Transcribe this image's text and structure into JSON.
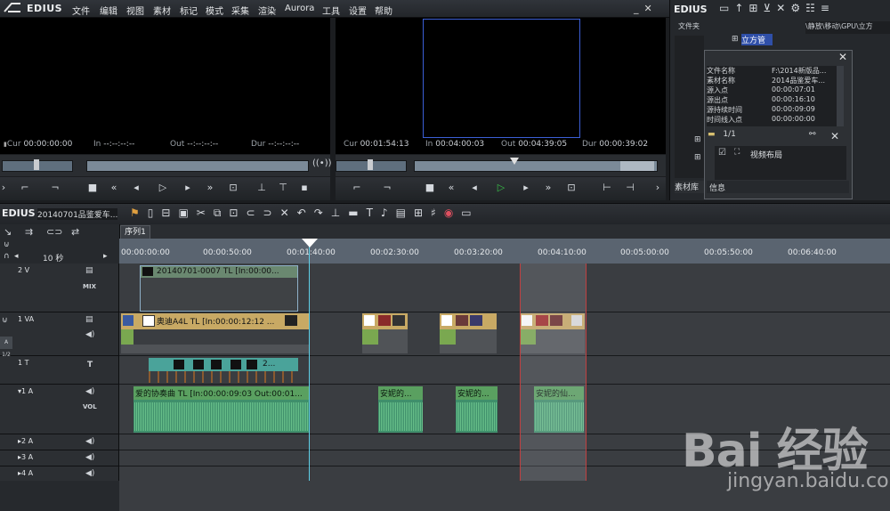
{
  "app": {
    "name": "EDIUS"
  },
  "menu": [
    "文件",
    "编辑",
    "视图",
    "素材",
    "标记",
    "模式",
    "采集",
    "渲染",
    "Aurora",
    "工具",
    "设置",
    "帮助"
  ],
  "player": {
    "cur_label": "Cur",
    "cur_value": "00:00:00:00",
    "in_label": "In",
    "in_value": "--:--:--:--",
    "out_label": "Out",
    "out_value": "--:--:--:--",
    "dur_label": "Dur",
    "dur_value": "--:--:--:--"
  },
  "recorder": {
    "cur_label": "Cur",
    "cur_value": "00:01:54:13",
    "in_label": "In",
    "in_value": "00:04:00:03",
    "out_label": "Out",
    "out_value": "00:04:39:05",
    "dur_label": "Dur",
    "dur_value": "00:00:39:02"
  },
  "bin": {
    "title": "EDIUS",
    "folder_header": "文件夹",
    "path": "\\静放\\移动\\GPU\\立方",
    "tree_item": "立方管",
    "tab_label": "素材库"
  },
  "info_panel": {
    "rows": [
      {
        "k": "文件名称",
        "v": "F:\\2014新版品..."
      },
      {
        "k": "素材名称",
        "v": "2014品鉴爱车..."
      },
      {
        "k": "源入点",
        "v": "00:00:07:01"
      },
      {
        "k": "源出点",
        "v": "00:00:16:10"
      },
      {
        "k": "源持续时间",
        "v": "00:00:09:09"
      },
      {
        "k": "时间线入点",
        "v": "00:00:00:00"
      }
    ],
    "page": "1/1",
    "layout_label": "视频布局",
    "tab": "信息"
  },
  "timeline": {
    "logo": "EDIUS",
    "project_name": "20140701品鉴爱车...",
    "sequence_tab": "序列1",
    "zoom": "10 秒",
    "ruler_ticks": [
      "00:00:00:00",
      "00:00:50:00",
      "00:01:40:00",
      "00:02:30:00",
      "00:03:20:00",
      "00:04:10:00",
      "00:05:00:00",
      "00:05:50:00",
      "00:06:40:00"
    ]
  },
  "tracks": [
    {
      "name": "2 V",
      "badge": "MIX"
    },
    {
      "name": "1 VA",
      "badge": "A 1/2"
    },
    {
      "name": "1 T",
      "badge": "T"
    },
    {
      "name": "▾1 A",
      "badge": "VOL"
    },
    {
      "name": "▸2 A",
      "badge": ""
    },
    {
      "name": "▸3 A",
      "badge": ""
    },
    {
      "name": "▸4 A",
      "badge": ""
    }
  ],
  "clips": {
    "v2_title": "20140701-0007  TL [In:00:00...",
    "va_title": "奥迪A4L  TL [In:00:00:12:12 ...",
    "t_title": "2...",
    "a1_title": "爱的协奏曲  TL [In:00:00:09:03 Out:00:01...",
    "a2_title": "安妮的...",
    "a3_title": "安妮的...",
    "a4_title": "安妮的仙..."
  },
  "watermark": {
    "main": "Bai 经验",
    "sub": "jingyan.baidu.com"
  },
  "colors": {
    "accent": "#3b5fd6",
    "playhead": "#5fd0e8",
    "range_edge": "#c04040",
    "play_green": "#38c048"
  }
}
